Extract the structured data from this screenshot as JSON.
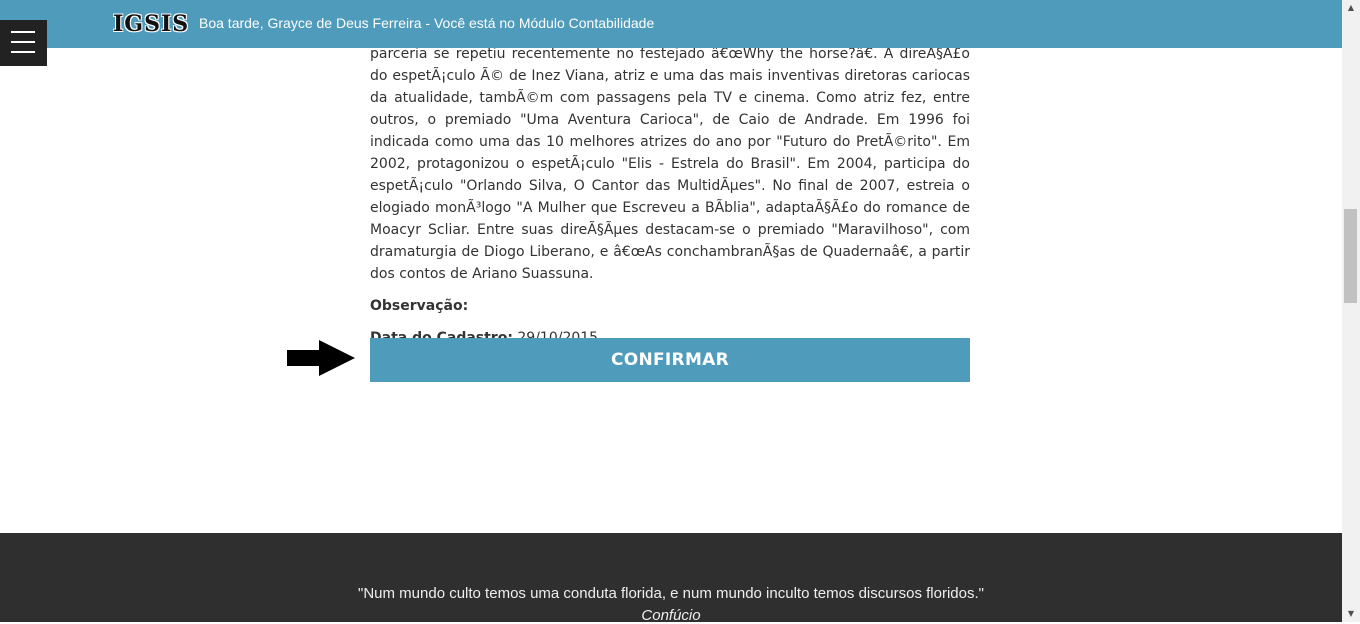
{
  "header": {
    "logo": "IGSIS",
    "greeting": "Boa tarde, Grayce de Deus Ferreira - Você está no Módulo Contabilidade"
  },
  "content": {
    "bio": "parceria se repetiu recentemente no festejado â€œWhy the horse?â€. A direÃ§Ã£o do espetÃ¡culo Ã© de Inez Viana, atriz e uma das mais inventivas diretoras cariocas da atualidade, tambÃ©m com passagens pela TV e cinema. Como atriz fez, entre outros, o premiado \"Uma Aventura Carioca\", de Caio de Andrade. Em 1996 foi indicada como uma das 10 melhores atrizes do ano por \"Futuro do PretÃ©rito\". Em 2002, protagonizou o espetÃ¡culo \"Elis - Estrela do Brasil\". Em 2004, participa do espetÃ¡culo \"Orlando Silva, O Cantor das MultidÃµes\". No final de 2007, estreia o elogiado monÃ³logo \"A Mulher que Escreveu a BÃblia\", adaptaÃ§Ã£o do romance de Moacyr Scliar. Entre suas direÃ§Ãµes destacam-se o premiado \"Maravilhoso\", com dramaturgia de Diogo Liberano, e â€œAs conchambranÃ§as de Quadernaâ€, a partir dos contos de Ariano Suassuna.",
    "observacao_label": "Observação:",
    "observacao_value": "",
    "data_cadastro_label": "Data do Cadastro:",
    "data_cadastro_value": "29/10/2015"
  },
  "actions": {
    "confirm_label": "CONFIRMAR"
  },
  "footer": {
    "quote": "\"Num mundo culto temos uma conduta florida, e num mundo inculto temos discursos floridos.\"",
    "author": "Confúcio"
  },
  "icons": {
    "menu": "hamburger-menu-icon",
    "arrow": "arrow-right-icon"
  },
  "colors": {
    "header": "#4f9bbc",
    "button": "#4f9bbc",
    "footer": "#2f2f2f",
    "menu": "#222222"
  }
}
